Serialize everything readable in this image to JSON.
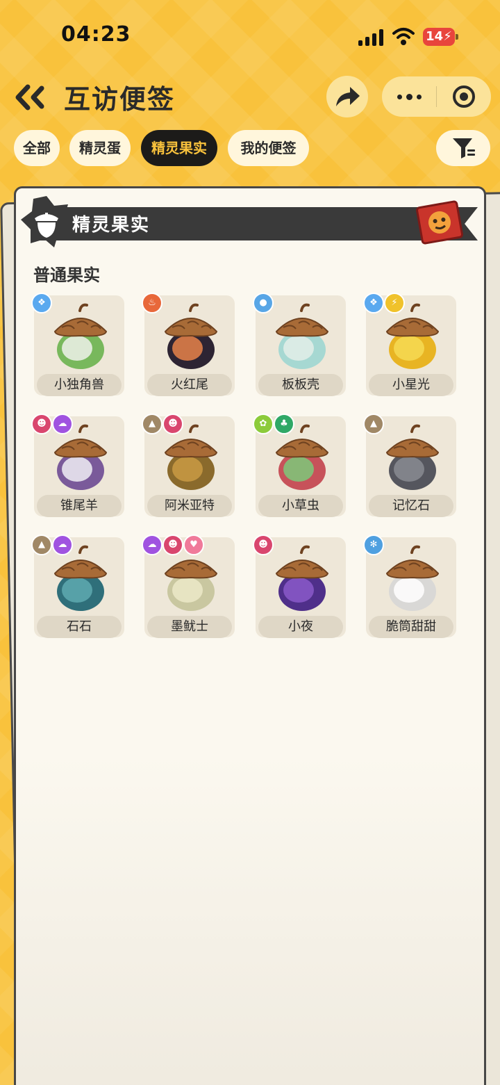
{
  "status_bar": {
    "time": "04:23",
    "battery": "14"
  },
  "nav": {
    "title": "互访便签"
  },
  "tabs": [
    {
      "label": "全部",
      "active": false
    },
    {
      "label": "精灵蛋",
      "active": false
    },
    {
      "label": "精灵果实",
      "active": true
    },
    {
      "label": "我的便签",
      "active": false
    }
  ],
  "panel": {
    "ribbon_title": "精灵果实",
    "section_title": "普通果实"
  },
  "attribute_colors": {
    "ice": "#5aa9ef",
    "fire": "#e8683a",
    "water": "#58a6e6",
    "electric": "#f0c22b",
    "demon": "#d9466e",
    "ghost": "#a053e0",
    "ground": "#a08866",
    "bug": "#8ccb3a",
    "grass": "#2fa866",
    "love": "#f07a9a",
    "snow": "#4fa0e0"
  },
  "fruits": [
    {
      "name": "小独角兽",
      "attributes": [
        "ice"
      ],
      "colors": [
        "#78b85c",
        "#eef1ea"
      ]
    },
    {
      "name": "火红尾",
      "attributes": [
        "fire"
      ],
      "colors": [
        "#2d2433",
        "#e7824a"
      ]
    },
    {
      "name": "板板壳",
      "attributes": [
        "water"
      ],
      "colors": [
        "#a6d8d2",
        "#e3efe9"
      ]
    },
    {
      "name": "小星光",
      "attributes": [
        "ice",
        "electric"
      ],
      "colors": [
        "#e8b423",
        "#f6da53"
      ]
    },
    {
      "name": "锥尾羊",
      "attributes": [
        "demon",
        "ghost"
      ],
      "colors": [
        "#7a5a9a",
        "#f0eef5"
      ]
    },
    {
      "name": "阿米亚特",
      "attributes": [
        "ground",
        "demon"
      ],
      "colors": [
        "#8a6a2c",
        "#c99a44"
      ]
    },
    {
      "name": "小草虫",
      "attributes": [
        "bug",
        "grass"
      ],
      "colors": [
        "#c7525a",
        "#7cc97a"
      ]
    },
    {
      "name": "记忆石",
      "attributes": [
        "ground"
      ],
      "colors": [
        "#55565e",
        "#8a8b92"
      ]
    },
    {
      "name": "石石",
      "attributes": [
        "ground",
        "ghost"
      ],
      "colors": [
        "#2f6f7a",
        "#5eaab0"
      ]
    },
    {
      "name": "墨鱿士",
      "attributes": [
        "ghost",
        "demon",
        "love"
      ],
      "colors": [
        "#c9c7a0",
        "#ece9c8"
      ]
    },
    {
      "name": "小夜",
      "attributes": [
        "demon"
      ],
      "colors": [
        "#4f2f8a",
        "#8a59c9"
      ]
    },
    {
      "name": "脆筒甜甜",
      "attributes": [
        "snow"
      ],
      "colors": [
        "#d9d8d6",
        "#ffffff"
      ]
    }
  ]
}
